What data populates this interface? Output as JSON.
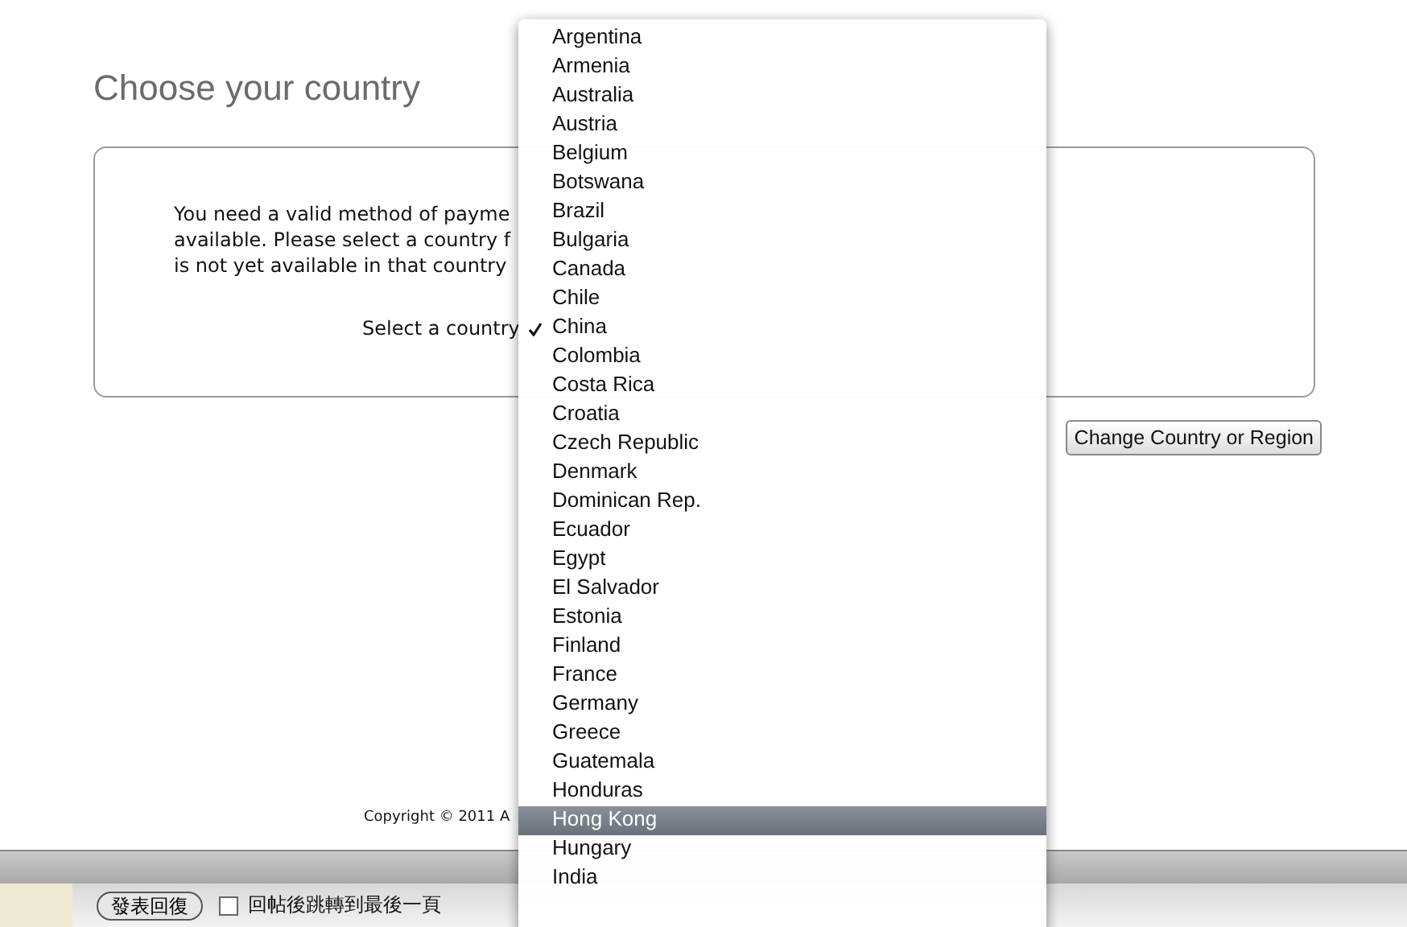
{
  "page": {
    "title": "Choose your country",
    "message_lines": [
      "You need a valid method of payme",
      "available. Please select a country f",
      "is not yet available in that country"
    ],
    "select_label": "Select a country",
    "buttons": [
      {
        "label": "Change Country or Region"
      }
    ],
    "copyright": "Copyright © 2011 A"
  },
  "country_menu": {
    "items": [
      {
        "label": "Argentina",
        "checked": false,
        "highlighted": false
      },
      {
        "label": "Armenia",
        "checked": false,
        "highlighted": false
      },
      {
        "label": "Australia",
        "checked": false,
        "highlighted": false
      },
      {
        "label": "Austria",
        "checked": false,
        "highlighted": false
      },
      {
        "label": "Belgium",
        "checked": false,
        "highlighted": false
      },
      {
        "label": "Botswana",
        "checked": false,
        "highlighted": false
      },
      {
        "label": "Brazil",
        "checked": false,
        "highlighted": false
      },
      {
        "label": "Bulgaria",
        "checked": false,
        "highlighted": false
      },
      {
        "label": "Canada",
        "checked": false,
        "highlighted": false
      },
      {
        "label": "Chile",
        "checked": false,
        "highlighted": false
      },
      {
        "label": "China",
        "checked": true,
        "highlighted": false
      },
      {
        "label": "Colombia",
        "checked": false,
        "highlighted": false
      },
      {
        "label": "Costa Rica",
        "checked": false,
        "highlighted": false
      },
      {
        "label": "Croatia",
        "checked": false,
        "highlighted": false
      },
      {
        "label": "Czech Republic",
        "checked": false,
        "highlighted": false
      },
      {
        "label": "Denmark",
        "checked": false,
        "highlighted": false
      },
      {
        "label": "Dominican Rep.",
        "checked": false,
        "highlighted": false
      },
      {
        "label": "Ecuador",
        "checked": false,
        "highlighted": false
      },
      {
        "label": "Egypt",
        "checked": false,
        "highlighted": false
      },
      {
        "label": "El Salvador",
        "checked": false,
        "highlighted": false
      },
      {
        "label": "Estonia",
        "checked": false,
        "highlighted": false
      },
      {
        "label": "Finland",
        "checked": false,
        "highlighted": false
      },
      {
        "label": "France",
        "checked": false,
        "highlighted": false
      },
      {
        "label": "Germany",
        "checked": false,
        "highlighted": false
      },
      {
        "label": "Greece",
        "checked": false,
        "highlighted": false
      },
      {
        "label": "Guatemala",
        "checked": false,
        "highlighted": false
      },
      {
        "label": "Honduras",
        "checked": false,
        "highlighted": false
      },
      {
        "label": "Hong Kong",
        "checked": false,
        "highlighted": true
      },
      {
        "label": "Hungary",
        "checked": false,
        "highlighted": false
      },
      {
        "label": "India",
        "checked": false,
        "highlighted": false
      }
    ]
  },
  "reply_bar": {
    "button": "發表回復",
    "checkbox": {
      "label": "回帖後跳轉到最後一頁",
      "checked": false
    }
  }
}
